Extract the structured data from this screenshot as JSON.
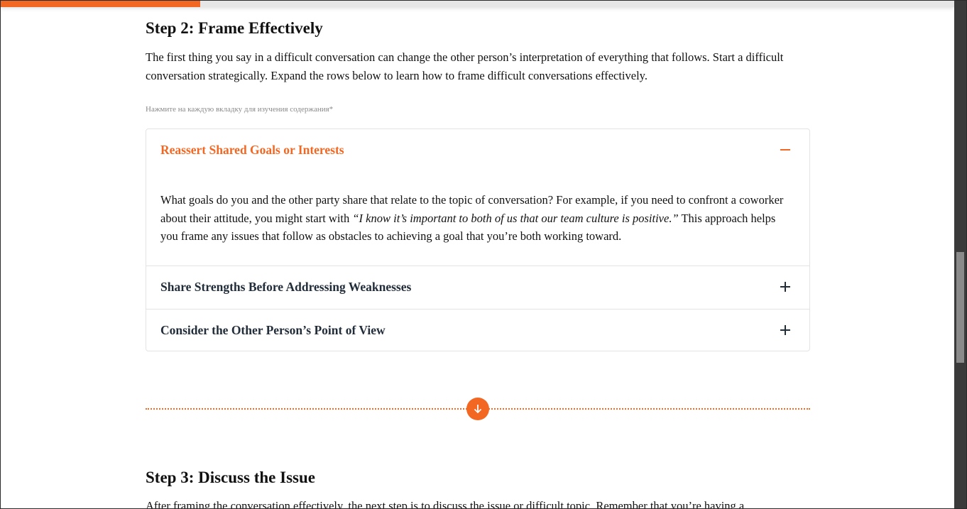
{
  "progress": {
    "fraction": 0.21,
    "color": "#f26722"
  },
  "step2": {
    "title": "Step 2: Frame Effectively",
    "intro": "The first thing you say in a difficult conversation can change the other person’s interpretation of everything that follows. Start a difficult conversation strategically. Expand the rows below to learn how to frame difficult conversations effectively."
  },
  "hint": "Нажмите на каждую вкладку для изучения содержания*",
  "accordion": {
    "items": [
      {
        "title": "Reassert Shared Goals or Interests",
        "expanded": true,
        "toggle_icon": "minus-icon",
        "body_before": "What goals do you and the other party share that relate to the topic of conversation? For example, if you need to confront a coworker about their attitude, you might start with ",
        "body_quote": "“I know it’s important to both of us that our team culture is positive.”",
        "body_after": " This approach helps you frame any issues that follow as obstacles to achieving a goal that you’re both working toward."
      },
      {
        "title": "Share Strengths Before Addressing Weaknesses",
        "expanded": false,
        "toggle_icon": "plus-icon"
      },
      {
        "title": "Consider the Other Person’s Point of View",
        "expanded": false,
        "toggle_icon": "plus-icon"
      }
    ]
  },
  "divider": {
    "icon": "arrow-down-icon"
  },
  "step3": {
    "title": "Step 3: Discuss the Issue",
    "intro": "After framing the conversation effectively, the next step is to discuss the issue or difficult topic. Remember that you’re having a"
  },
  "colors": {
    "accent": "#f26722",
    "heading": "#222d3a",
    "text": "#111111",
    "hint": "#8a8a8a",
    "border": "#e3e3e3"
  }
}
